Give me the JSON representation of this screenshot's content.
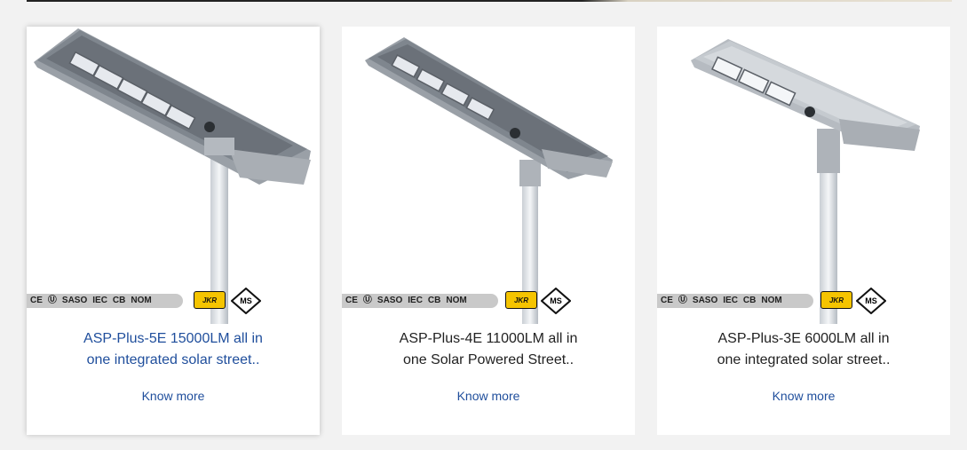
{
  "products": [
    {
      "title_line1": "ASP-Plus-5E 15000LM all in",
      "title_line2": "one integrated solar street..",
      "link": "Know more",
      "led_modules": 5,
      "image_alt": "all in one solar street light product image"
    },
    {
      "title_line1": "ASP-Plus-4E 11000LM all in",
      "title_line2": "one Solar Powered Street..",
      "link": "Know more",
      "led_modules": 4,
      "image_alt": "all in one solar street light product image"
    },
    {
      "title_line1": "ASP-Plus-3E 6000LM all in",
      "title_line2": "one integrated solar street..",
      "link": "Know more",
      "led_modules": 3,
      "image_alt": "all in one solar street light product image"
    }
  ],
  "certifications": {
    "ce": "CE",
    "saso": "SASO",
    "iec": "IEC",
    "cb": "CB",
    "nom": "NOM",
    "jkr": "JKR",
    "ms": "MS"
  },
  "colors": {
    "link": "#1f4e9c",
    "jkr_badge": "#f5c400",
    "page_background": "#f2f2f2"
  }
}
